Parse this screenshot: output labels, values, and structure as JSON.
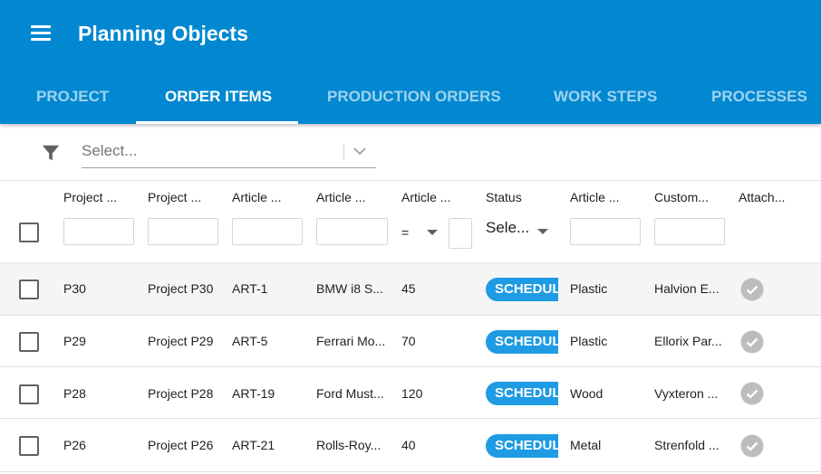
{
  "appbar": {
    "title": "Planning Objects",
    "menu_icon": "hamburger-menu-icon",
    "color": "#0288d1"
  },
  "tabs": [
    {
      "label": "PROJECT",
      "active": false
    },
    {
      "label": "ORDER ITEMS",
      "active": true
    },
    {
      "label": "PRODUCTION ORDERS",
      "active": false
    },
    {
      "label": "WORK STEPS",
      "active": false
    },
    {
      "label": "PROCESSES",
      "active": false
    }
  ],
  "filter": {
    "icon": "filter-icon",
    "placeholder": "Select..."
  },
  "table": {
    "columns": [
      "Project ...",
      "Project ...",
      "Article ...",
      "Article ...",
      "Article ...",
      "Status",
      "Article ...",
      "Custom...",
      "Attach..."
    ],
    "quantity_operator": "=",
    "status_filter": "Sele...",
    "rows": [
      {
        "project_id": "P30",
        "project_name": "Project P30",
        "article_id": "ART-1",
        "article_name": "BMW i8 S...",
        "quantity": "45",
        "status": "SCHEDULED",
        "material": "Plastic",
        "customer": "Halvion E...",
        "attached": true
      },
      {
        "project_id": "P29",
        "project_name": "Project P29",
        "article_id": "ART-5",
        "article_name": "Ferrari Mo...",
        "quantity": "70",
        "status": "SCHEDULED",
        "material": "Plastic",
        "customer": "Ellorix Par...",
        "attached": true
      },
      {
        "project_id": "P28",
        "project_name": "Project P28",
        "article_id": "ART-19",
        "article_name": "Ford Must...",
        "quantity": "120",
        "status": "SCHEDULED",
        "material": "Wood",
        "customer": "Vyxteron ...",
        "attached": true
      },
      {
        "project_id": "P26",
        "project_name": "Project P26",
        "article_id": "ART-21",
        "article_name": "Rolls-Roy...",
        "quantity": "40",
        "status": "SCHEDULED",
        "material": "Metal",
        "customer": "Strenfold ...",
        "attached": true
      }
    ],
    "status_color": "#1e9be3"
  }
}
